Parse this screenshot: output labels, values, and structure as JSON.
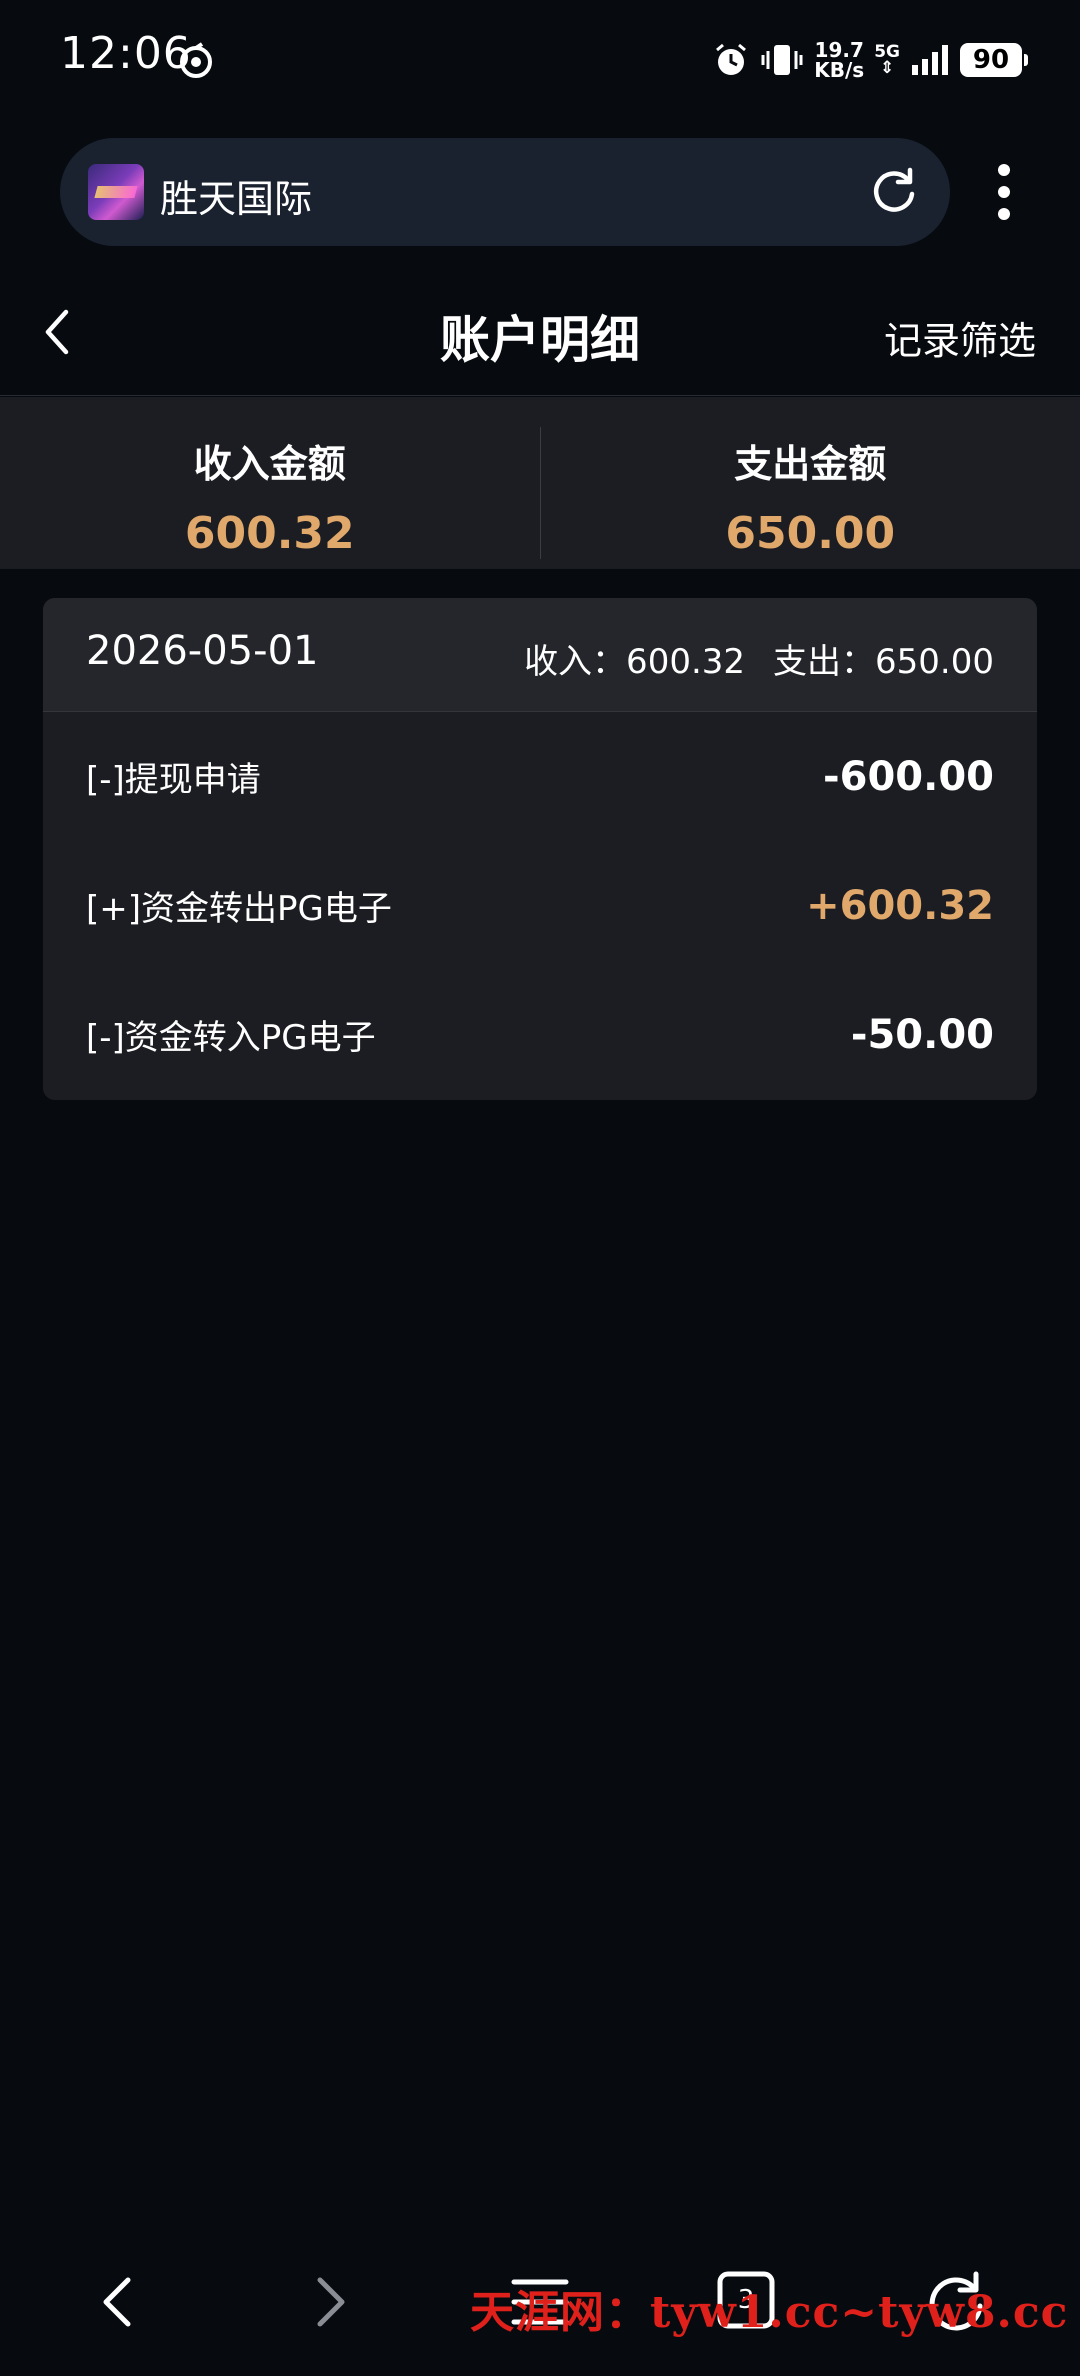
{
  "status_bar": {
    "time": "12:06",
    "net_speed_value": "19.7",
    "net_speed_unit": "KB/s",
    "network_type": "5G",
    "battery": "90"
  },
  "browser": {
    "site_name": "胜天国际",
    "tab_count": "3"
  },
  "header": {
    "title": "账户明细",
    "filter_label": "记录筛选"
  },
  "summary": {
    "income_label": "收入金额",
    "income_value": "600.32",
    "expense_label": "支出金额",
    "expense_value": "650.00"
  },
  "records": {
    "date": "2026-05-01",
    "income_text": "收入：600.32",
    "expense_text": "支出：650.00",
    "items": [
      {
        "description": "[-]提现申请",
        "amount": "-600.00"
      },
      {
        "description": "[+]资金转出PG电子",
        "amount": "+600.32"
      },
      {
        "description": "[-]资金转入PG电子",
        "amount": "-50.00"
      }
    ]
  },
  "watermark": "天涯网：tyw1.cc~tyw8.cc",
  "colors": {
    "background": "#070b10",
    "accent": "#e0a86a",
    "card": "#1c1d22",
    "watermark": "#e0201a"
  }
}
